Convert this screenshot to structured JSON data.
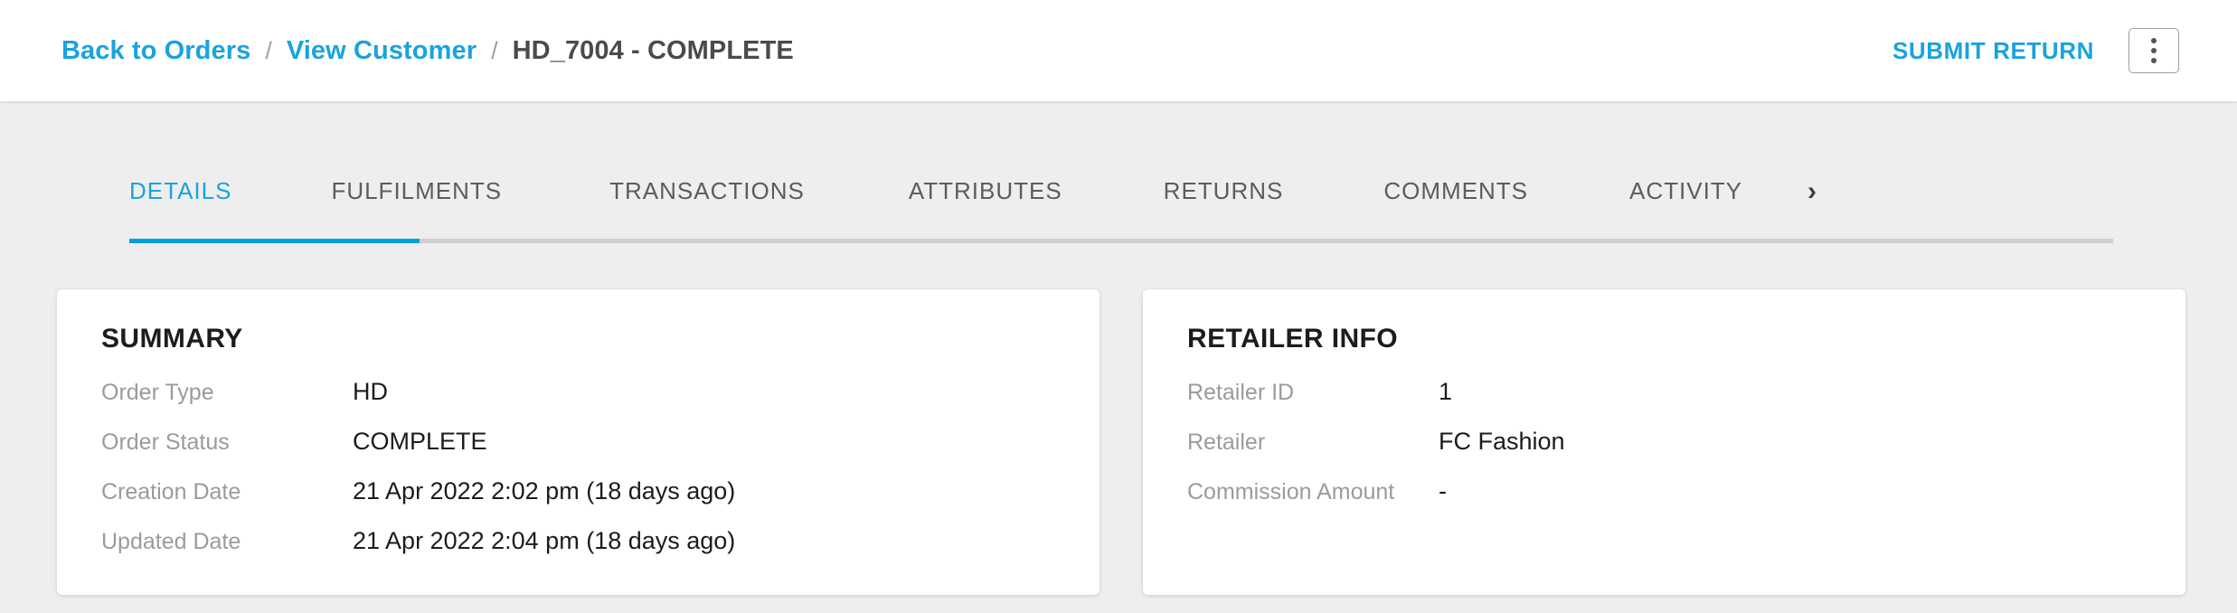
{
  "header": {
    "breadcrumb": {
      "back_to_orders": "Back to Orders",
      "separator": "/",
      "view_customer": "View Customer",
      "current": "HD_7004 - COMPLETE"
    },
    "submit_return_label": "SUBMIT RETURN",
    "overflow_menu_icon": "kebab-menu-icon"
  },
  "tabs": {
    "items": [
      {
        "label": "DETAILS",
        "active": true
      },
      {
        "label": "FULFILMENTS",
        "active": false
      },
      {
        "label": "TRANSACTIONS",
        "active": false
      },
      {
        "label": "ATTRIBUTES",
        "active": false
      },
      {
        "label": "RETURNS",
        "active": false
      },
      {
        "label": "COMMENTS",
        "active": false
      },
      {
        "label": "ACTIVITY",
        "active": false
      }
    ],
    "scroll_next_icon": "chevron-right-icon",
    "scroll_next_glyph": "›"
  },
  "cards": [
    {
      "title": "SUMMARY",
      "fields": [
        {
          "label": "Order Type",
          "value": "HD"
        },
        {
          "label": "Order Status",
          "value": "COMPLETE"
        },
        {
          "label": "Creation Date",
          "value": "21 Apr 2022 2:02 pm (18 days ago)"
        },
        {
          "label": "Updated Date",
          "value": "21 Apr 2022 2:04 pm (18 days ago)"
        }
      ]
    },
    {
      "title": "RETAILER INFO",
      "fields": [
        {
          "label": "Retailer ID",
          "value": "1"
        },
        {
          "label": "Retailer",
          "value": "FC Fashion"
        },
        {
          "label": "Commission Amount",
          "value": "-"
        }
      ]
    }
  ],
  "colors": {
    "accent_blue": "#19a3dd",
    "tab_underline": "#00a0dd",
    "page_background": "#eeeeee",
    "card_background": "#ffffff",
    "label_grey": "#9b9b9b",
    "value_dark": "#1c1c1c"
  }
}
